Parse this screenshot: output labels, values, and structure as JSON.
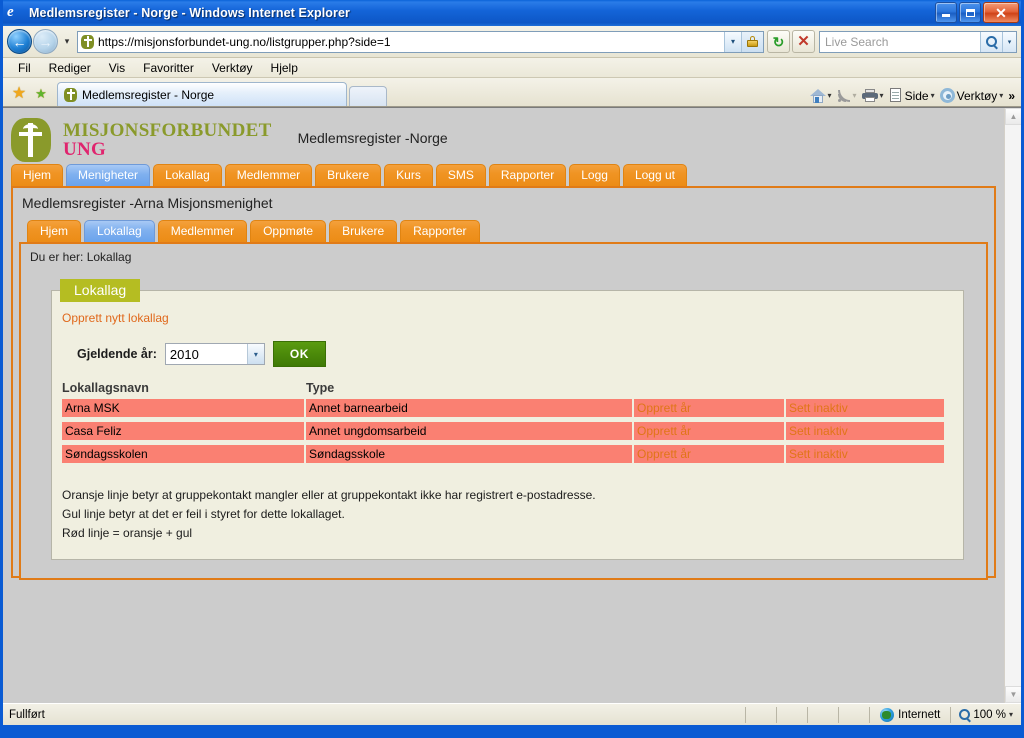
{
  "window": {
    "title": "Medlemsregister - Norge - Windows Internet Explorer",
    "minimize_label": "Minimer",
    "restore_label": "Gjenopprett",
    "close_label": "Lukk"
  },
  "navbar": {
    "back_label": "Tilbake",
    "forward_label": "Frem",
    "history_caret": "▾",
    "url": "https://misjonsforbundet-ung.no/listgrupper.php?side=1",
    "url_caret": "▾",
    "refresh_glyph": "↻",
    "stop_glyph": "✕",
    "search_placeholder": "Live Search",
    "search_caret": "▾"
  },
  "menubar": {
    "items": [
      {
        "label": "Fil"
      },
      {
        "label": "Rediger"
      },
      {
        "label": "Vis"
      },
      {
        "label": "Favoritter"
      },
      {
        "label": "Verktøy"
      },
      {
        "label": "Hjelp"
      }
    ]
  },
  "tabstrip": {
    "browser_tab_label": "Medlemsregister - Norge",
    "new_tab_label": "",
    "tools": [
      {
        "label": "",
        "name": "home-icon"
      },
      {
        "label": "",
        "name": "feeds-icon"
      },
      {
        "label": "",
        "name": "print-icon"
      },
      {
        "label": "Side",
        "name": "page-menu"
      },
      {
        "label": "Verktøy",
        "name": "tools-menu"
      }
    ],
    "overflow_glyph": "»"
  },
  "site": {
    "brand_line1": "MISJONSFORBUNDET",
    "brand_line2": "UNG",
    "subtitle": "Medlemsregister -Norge",
    "logo_name": "shield-cross-logo"
  },
  "main_nav": {
    "items": [
      {
        "label": "Hjem",
        "active": false
      },
      {
        "label": "Menigheter",
        "active": true
      },
      {
        "label": "Lokallag",
        "active": false
      },
      {
        "label": "Medlemmer",
        "active": false
      },
      {
        "label": "Brukere",
        "active": false
      },
      {
        "label": "Kurs",
        "active": false
      },
      {
        "label": "SMS",
        "active": false
      },
      {
        "label": "Rapporter",
        "active": false
      },
      {
        "label": "Logg",
        "active": false
      },
      {
        "label": "Logg ut",
        "active": false
      }
    ]
  },
  "panel": {
    "title": "Medlemsregister -Arna Misjonsmenighet",
    "breadcrumb": "Du er her: Lokallag"
  },
  "sub_nav": {
    "items": [
      {
        "label": "Hjem",
        "active": false
      },
      {
        "label": "Lokallag",
        "active": true
      },
      {
        "label": "Medlemmer",
        "active": false
      },
      {
        "label": "Oppmøte",
        "active": false
      },
      {
        "label": "Brukere",
        "active": false
      },
      {
        "label": "Rapporter",
        "active": false
      }
    ]
  },
  "card": {
    "tab_label": "Lokallag",
    "create_link": "Opprett nytt lokallag",
    "year_label": "Gjeldende år:",
    "year_value": "2010",
    "year_caret": "▾",
    "ok_label": "OK"
  },
  "table": {
    "headers": [
      "Lokallagsnavn",
      "Type"
    ],
    "rows": [
      {
        "name": "Arna MSK",
        "type": "Annet barnearbeid",
        "action1": "Opprett år",
        "action2": "Sett inaktiv"
      },
      {
        "name": "Casa Feliz",
        "type": "Annet ungdomsarbeid",
        "action1": "Opprett år",
        "action2": "Sett inaktiv"
      },
      {
        "name": "Søndagsskolen",
        "type": "Søndagsskole",
        "action1": "Opprett år",
        "action2": "Sett inaktiv"
      }
    ],
    "row_color": "#fa8072",
    "action_color": "#e07518"
  },
  "legend": {
    "lines": [
      "Oransje linje betyr at gruppekontakt mangler eller at gruppekontakt ikke har registrert e-postadresse.",
      "Gul linje betyr at det er feil i styret for dette lokallaget.",
      "Rød linje = oransje + gul"
    ]
  },
  "scrollbar": {
    "up_glyph": "▲",
    "down_glyph": "▼"
  },
  "statusbar": {
    "status": "Fullført",
    "zone": "Internett",
    "zoom": "100 %",
    "zoom_caret": "▾"
  },
  "colors": {
    "tab_orange": "#f09423",
    "tab_active_blue": "#7fb0ef",
    "brand_green": "#8a9a2b",
    "brand_pink": "#e0246e",
    "card_tab_olive": "#b5bd22",
    "panel_border": "#e07b17",
    "ok_green": "#4c8a0a",
    "row_salmon": "#fa8072"
  }
}
